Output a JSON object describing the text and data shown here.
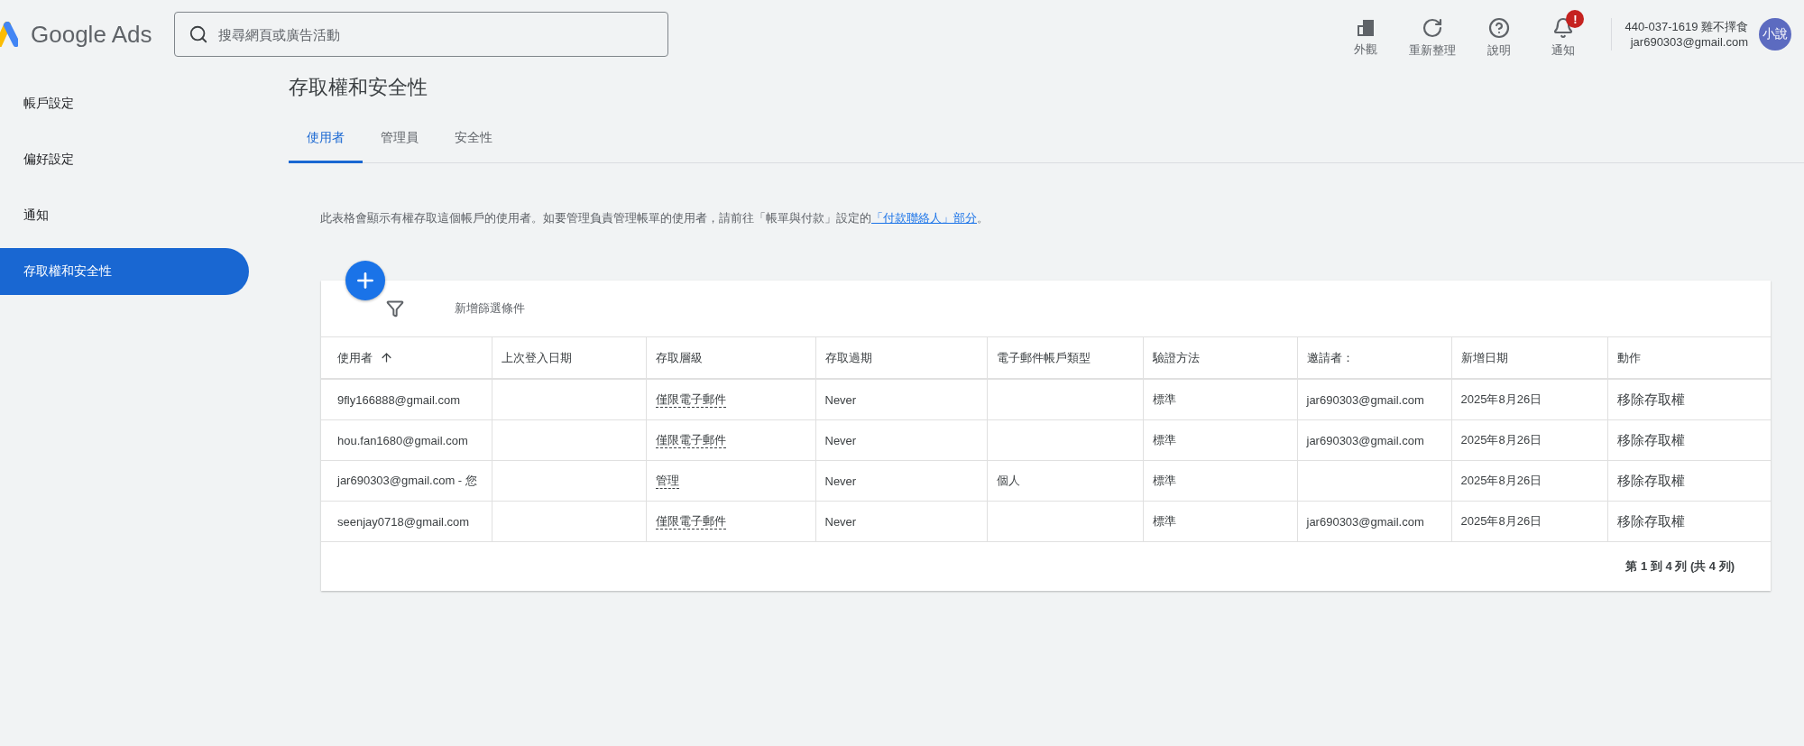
{
  "header": {
    "logo_text": "Google Ads",
    "search": {
      "placeholder": "搜尋網頁或廣告活動"
    },
    "tools": [
      {
        "kind": "appearance",
        "label": "外觀"
      },
      {
        "kind": "refresh",
        "label": "重新整理"
      },
      {
        "kind": "help",
        "label": "說明"
      },
      {
        "kind": "notifications",
        "label": "通知",
        "badge": "!"
      }
    ],
    "account": {
      "name": "440-037-1619 雞不擇食",
      "email": "jar690303@gmail.com",
      "avatar": "小說"
    }
  },
  "sidebar": {
    "items": [
      {
        "label": "帳戶設定",
        "selected": false
      },
      {
        "label": "偏好設定",
        "selected": false
      },
      {
        "label": "通知",
        "selected": false
      },
      {
        "label": "存取權和安全性",
        "selected": true
      }
    ]
  },
  "page_title": "存取權和安全性",
  "tabs": [
    {
      "label": "使用者",
      "selected": true
    },
    {
      "label": "管理員",
      "selected": false
    },
    {
      "label": "安全性",
      "selected": false
    }
  ],
  "description": {
    "text": "此表格會顯示有權存取這個帳戶的使用者。如要管理負責管理帳單的使用者，請前往「帳單與付款」設定的",
    "link": "「付款聯絡人」部分",
    "suffix": "。"
  },
  "filter": {
    "label": "新增篩選條件"
  },
  "table": {
    "columns": [
      {
        "label": "使用者",
        "sorted_ascending": true
      },
      {
        "label": "上次登入日期",
        "sorted_ascending": false
      },
      {
        "label": "存取層級",
        "sorted_ascending": false
      },
      {
        "label": "存取過期",
        "sorted_ascending": false
      },
      {
        "label": "電子郵件帳戶類型",
        "sorted_ascending": false
      },
      {
        "label": "驗證方法",
        "sorted_ascending": false
      },
      {
        "label": "邀請者：",
        "sorted_ascending": false
      },
      {
        "label": "新增日期",
        "sorted_ascending": false
      },
      {
        "label": "動作",
        "sorted_ascending": false
      }
    ],
    "rows": [
      {
        "cells": [
          "9fly166888@gmail.com",
          "",
          "僅限電子郵件",
          "Never",
          "",
          "標準",
          "jar690303@gmail.com",
          "2025年8月26日",
          "移除存取權"
        ]
      },
      {
        "cells": [
          "hou.fan1680@gmail.com",
          "",
          "僅限電子郵件",
          "Never",
          "",
          "標準",
          "jar690303@gmail.com",
          "2025年8月26日",
          "移除存取權"
        ]
      },
      {
        "cells": [
          "jar690303@gmail.com - 您",
          "",
          "管理",
          "Never",
          "個人",
          "標準",
          "",
          "2025年8月26日",
          "移除存取權"
        ]
      },
      {
        "cells": [
          "seenjay0718@gmail.com",
          "",
          "僅限電子郵件",
          "Never",
          "",
          "標準",
          "jar690303@gmail.com",
          "2025年8月26日",
          "移除存取權"
        ]
      }
    ],
    "pagination": "第 1 到 4 列 (共 4 列)"
  }
}
